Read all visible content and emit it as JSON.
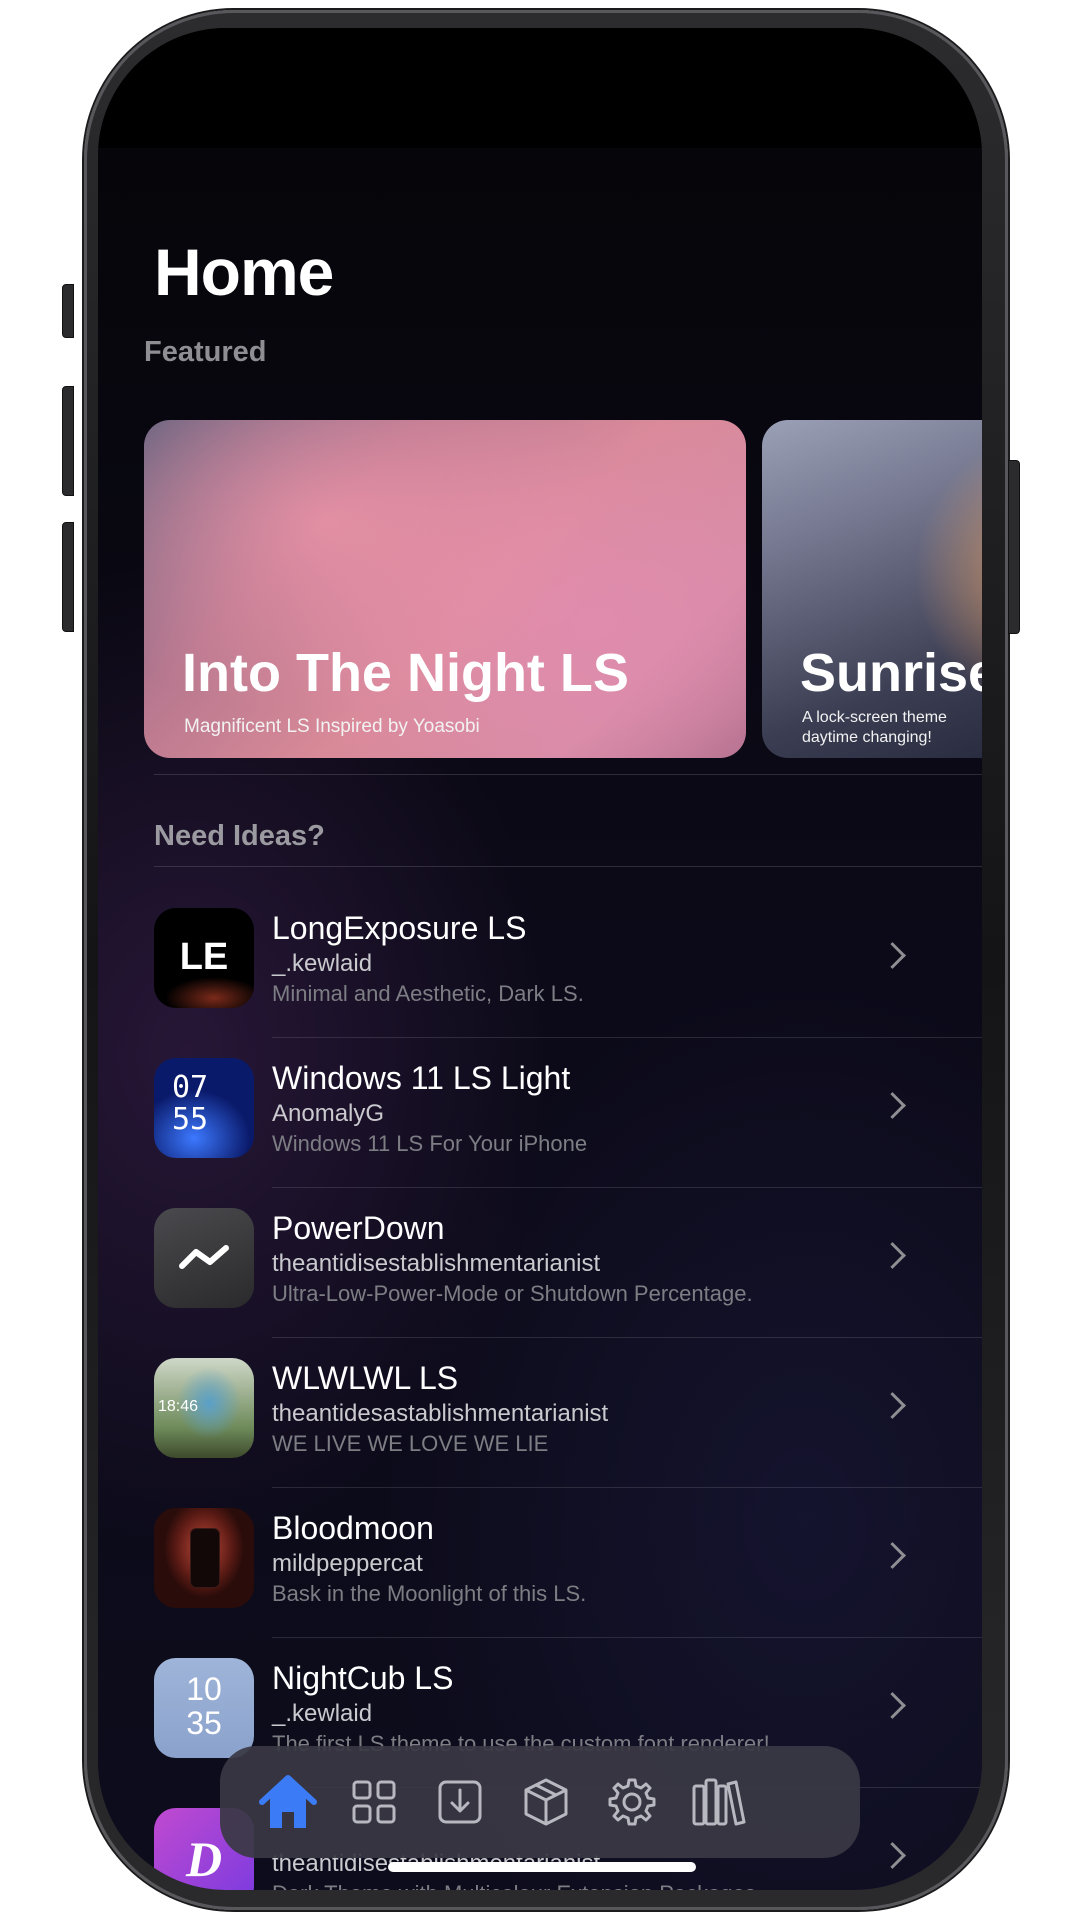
{
  "page": {
    "title": "Home"
  },
  "featured": {
    "label": "Featured",
    "cards": [
      {
        "title": "Into The Night LS",
        "subtitle": "Magnificent LS Inspired by Yoasobi"
      },
      {
        "title": "Sunrise",
        "subtitle": "A lock-screen theme daytime changing!"
      }
    ]
  },
  "ideas": {
    "label": "Need Ideas?",
    "items": [
      {
        "title": "LongExposure LS",
        "author": "_.kewlaid",
        "desc": "Minimal and Aesthetic, Dark LS.",
        "thumb_text": "LE"
      },
      {
        "title": "Windows 11 LS Light",
        "author": "AnomalyG",
        "desc": "Windows 11 LS For Your iPhone",
        "thumb_text": "07 55"
      },
      {
        "title": "PowerDown",
        "author": "theantidisestablishmentarianist",
        "desc": "Ultra-Low-Power-Mode or Shutdown Percentage.",
        "thumb_text": ""
      },
      {
        "title": "WLWLWL LS",
        "author": "theantidesastablishmentarianist",
        "desc": "WE LIVE WE LOVE WE LIE",
        "thumb_text": "18:46"
      },
      {
        "title": "Bloodmoon",
        "author": "mildpeppercat",
        "desc": "Bask in the Moonlight of this LS.",
        "thumb_text": ""
      },
      {
        "title": "NightCub LS",
        "author": "_.kewlaid",
        "desc": "The first LS theme to use the custom font renderer!",
        "thumb_text": "10 35"
      },
      {
        "title": "",
        "author": "theantidisestablishmentarianist",
        "desc": "Dark Theme with Multicolour Extension Packages",
        "thumb_text": "D"
      }
    ]
  },
  "tabbar": {
    "tabs": [
      {
        "icon": "house-icon",
        "active": true
      },
      {
        "icon": "grid-icon"
      },
      {
        "icon": "download-tray-icon"
      },
      {
        "icon": "package-box-icon"
      },
      {
        "icon": "gear-icon"
      },
      {
        "icon": "library-books-icon"
      }
    ],
    "active_color": "#3b7cf6",
    "inactive_color": "#b8b8c0"
  }
}
